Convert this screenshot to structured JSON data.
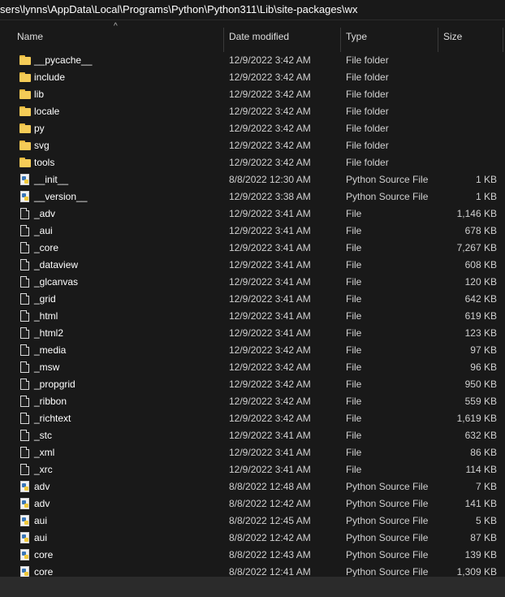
{
  "address": {
    "path": "sers\\lynns\\AppData\\Local\\Programs\\Python\\Python311\\Lib\\site-packages\\wx"
  },
  "columns": {
    "name": "Name",
    "date": "Date modified",
    "type": "Type",
    "size": "Size"
  },
  "sort_arrow": "^",
  "rows": [
    {
      "name": "__pycache__",
      "date": "12/9/2022 3:42 AM",
      "type": "File folder",
      "size": "",
      "icon": "folder"
    },
    {
      "name": "include",
      "date": "12/9/2022 3:42 AM",
      "type": "File folder",
      "size": "",
      "icon": "folder"
    },
    {
      "name": "lib",
      "date": "12/9/2022 3:42 AM",
      "type": "File folder",
      "size": "",
      "icon": "folder"
    },
    {
      "name": "locale",
      "date": "12/9/2022 3:42 AM",
      "type": "File folder",
      "size": "",
      "icon": "folder"
    },
    {
      "name": "py",
      "date": "12/9/2022 3:42 AM",
      "type": "File folder",
      "size": "",
      "icon": "folder"
    },
    {
      "name": "svg",
      "date": "12/9/2022 3:42 AM",
      "type": "File folder",
      "size": "",
      "icon": "folder"
    },
    {
      "name": "tools",
      "date": "12/9/2022 3:42 AM",
      "type": "File folder",
      "size": "",
      "icon": "folder"
    },
    {
      "name": "__init__",
      "date": "8/8/2022 12:30 AM",
      "type": "Python Source File",
      "size": "1 KB",
      "icon": "python"
    },
    {
      "name": "__version__",
      "date": "12/9/2022 3:38 AM",
      "type": "Python Source File",
      "size": "1 KB",
      "icon": "python"
    },
    {
      "name": "_adv",
      "date": "12/9/2022 3:41 AM",
      "type": "File",
      "size": "1,146 KB",
      "icon": "file"
    },
    {
      "name": "_aui",
      "date": "12/9/2022 3:41 AM",
      "type": "File",
      "size": "678 KB",
      "icon": "file"
    },
    {
      "name": "_core",
      "date": "12/9/2022 3:41 AM",
      "type": "File",
      "size": "7,267 KB",
      "icon": "file"
    },
    {
      "name": "_dataview",
      "date": "12/9/2022 3:41 AM",
      "type": "File",
      "size": "608 KB",
      "icon": "file"
    },
    {
      "name": "_glcanvas",
      "date": "12/9/2022 3:41 AM",
      "type": "File",
      "size": "120 KB",
      "icon": "file"
    },
    {
      "name": "_grid",
      "date": "12/9/2022 3:41 AM",
      "type": "File",
      "size": "642 KB",
      "icon": "file"
    },
    {
      "name": "_html",
      "date": "12/9/2022 3:41 AM",
      "type": "File",
      "size": "619 KB",
      "icon": "file"
    },
    {
      "name": "_html2",
      "date": "12/9/2022 3:41 AM",
      "type": "File",
      "size": "123 KB",
      "icon": "file"
    },
    {
      "name": "_media",
      "date": "12/9/2022 3:42 AM",
      "type": "File",
      "size": "97 KB",
      "icon": "file"
    },
    {
      "name": "_msw",
      "date": "12/9/2022 3:42 AM",
      "type": "File",
      "size": "96 KB",
      "icon": "file"
    },
    {
      "name": "_propgrid",
      "date": "12/9/2022 3:42 AM",
      "type": "File",
      "size": "950 KB",
      "icon": "file"
    },
    {
      "name": "_ribbon",
      "date": "12/9/2022 3:42 AM",
      "type": "File",
      "size": "559 KB",
      "icon": "file"
    },
    {
      "name": "_richtext",
      "date": "12/9/2022 3:42 AM",
      "type": "File",
      "size": "1,619 KB",
      "icon": "file"
    },
    {
      "name": "_stc",
      "date": "12/9/2022 3:41 AM",
      "type": "File",
      "size": "632 KB",
      "icon": "file"
    },
    {
      "name": "_xml",
      "date": "12/9/2022 3:41 AM",
      "type": "File",
      "size": "86 KB",
      "icon": "file"
    },
    {
      "name": "_xrc",
      "date": "12/9/2022 3:41 AM",
      "type": "File",
      "size": "114 KB",
      "icon": "file"
    },
    {
      "name": "adv",
      "date": "8/8/2022 12:48 AM",
      "type": "Python Source File",
      "size": "7 KB",
      "icon": "python"
    },
    {
      "name": "adv",
      "date": "8/8/2022 12:42 AM",
      "type": "Python Source File",
      "size": "141 KB",
      "icon": "python"
    },
    {
      "name": "aui",
      "date": "8/8/2022 12:45 AM",
      "type": "Python Source File",
      "size": "5 KB",
      "icon": "python"
    },
    {
      "name": "aui",
      "date": "8/8/2022 12:42 AM",
      "type": "Python Source File",
      "size": "87 KB",
      "icon": "python"
    },
    {
      "name": "core",
      "date": "8/8/2022 12:43 AM",
      "type": "Python Source File",
      "size": "139 KB",
      "icon": "python"
    },
    {
      "name": "core",
      "date": "8/8/2022 12:41 AM",
      "type": "Python Source File",
      "size": "1,309 KB",
      "icon": "python"
    }
  ]
}
